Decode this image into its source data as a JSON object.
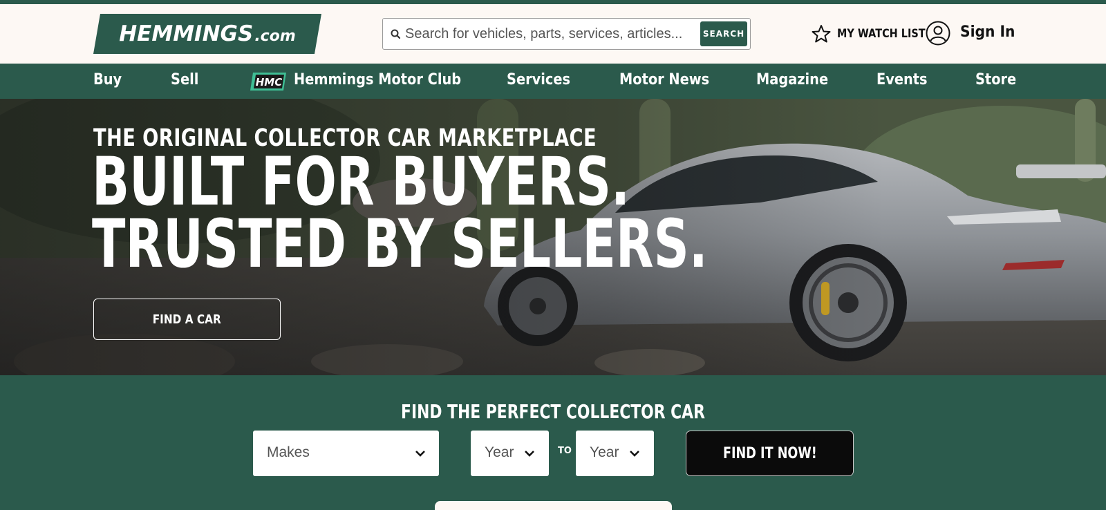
{
  "header": {
    "logo_main": "HEMMINGS",
    "logo_suffix": ".com",
    "search": {
      "placeholder": "Search for vehicles, parts, services, articles...",
      "button_label": "SEARCH"
    },
    "watch_list_label": "MY WATCH LIST",
    "sign_in_label": "Sign In"
  },
  "nav": {
    "items": [
      {
        "label": "Buy"
      },
      {
        "label": "Sell"
      },
      {
        "label": "Hemmings Motor Club",
        "badge": "HMC"
      },
      {
        "label": "Services"
      },
      {
        "label": "Motor News"
      },
      {
        "label": "Magazine"
      },
      {
        "label": "Events"
      },
      {
        "label": "Store"
      }
    ]
  },
  "hero": {
    "kicker": "THE ORIGINAL COLLECTOR CAR MARKETPLACE",
    "title_line1": "BUILT FOR BUYERS.",
    "title_line2": "TRUSTED BY SELLERS.",
    "cta_label": "FIND A CAR"
  },
  "finder": {
    "title": "FIND THE PERFECT COLLECTOR CAR",
    "make_select": "Makes",
    "year_from_select": "Year",
    "to_label": "TO",
    "year_to_select": "Year",
    "submit_label": "FIND IT NOW!"
  },
  "colors": {
    "brand_green": "#2b5a4c",
    "cream": "#fdf8f4",
    "accent_mint": "#3fbf95",
    "black": "#0b0b0b"
  },
  "icons": [
    "search-icon",
    "star-icon",
    "user-icon",
    "chevron-down-icon",
    "hmc-badge-icon"
  ]
}
